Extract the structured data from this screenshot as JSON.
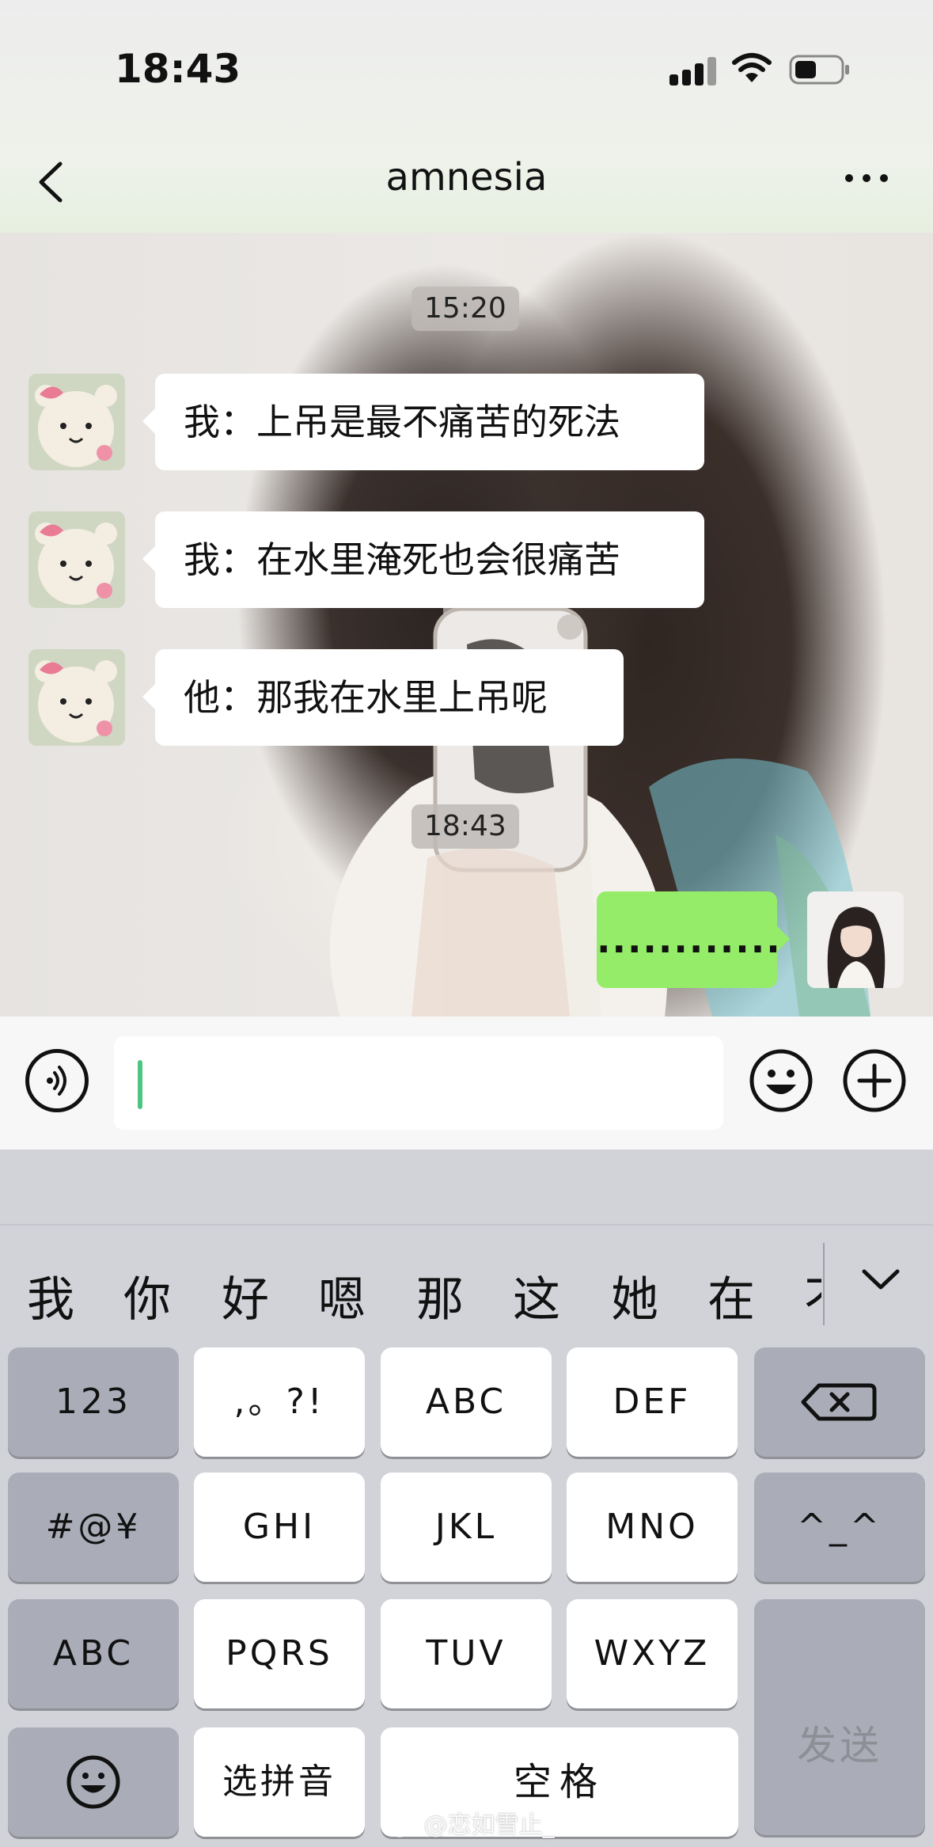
{
  "status_bar": {
    "time": "18:43"
  },
  "nav": {
    "title": "amnesia"
  },
  "messages": {
    "timestamp_1": "15:20",
    "msg_1": "我：上吊是最不痛苦的死法",
    "msg_2": "我：在水里淹死也会很痛苦",
    "msg_3": "他：那我在水里上吊呢",
    "timestamp_2": "18:43",
    "msg_4": "............"
  },
  "input": {
    "value": ""
  },
  "keyboard": {
    "candidates": [
      "我",
      "你",
      "好",
      "嗯",
      "那",
      "这",
      "她",
      "在",
      "不"
    ],
    "keys": {
      "num": "123",
      "punct": ",。?!",
      "abc": "ABC",
      "def": "DEF",
      "symbols": "#@¥",
      "ghi": "GHI",
      "jkl": "JKL",
      "mno": "MNO",
      "kaomoji": "^_^",
      "abc_mode": "ABC",
      "pqrs": "PQRS",
      "tuv": "TUV",
      "wxyz": "WXYZ",
      "send": "发送",
      "pinyin": "选拼音",
      "space": "空格"
    }
  },
  "watermark": "@恋如雪止_",
  "colors": {
    "accent_green": "#95ec69",
    "caret": "#4fc583"
  }
}
